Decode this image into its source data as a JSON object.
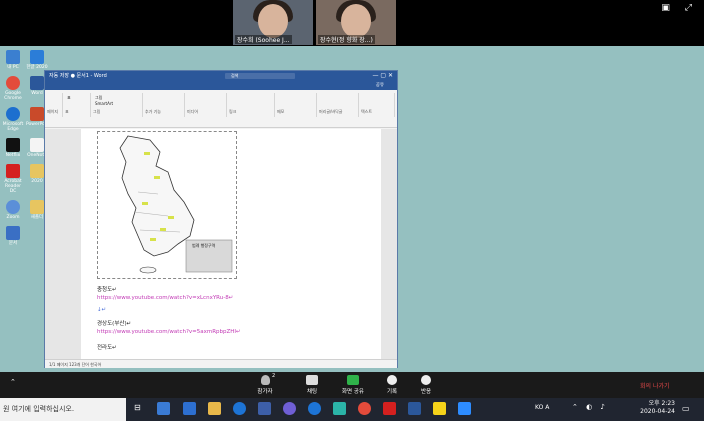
{
  "participants": [
    {
      "name": "장수희 (Soohee J..."
    },
    {
      "name": "장수현(정 향화 장...)"
    }
  ],
  "desktop_icons": [
    {
      "label": "내 PC"
    },
    {
      "label": "한글 2020"
    },
    {
      "label": "Google Chrome"
    },
    {
      "label": "Word"
    },
    {
      "label": "Microsoft Edge"
    },
    {
      "label": "PowerPoint"
    },
    {
      "label": "Netflix"
    },
    {
      "label": "OneNote"
    },
    {
      "label": "Acrobat Reader DC"
    },
    {
      "label": "2020"
    },
    {
      "label": "Zoom"
    },
    {
      "label": "새폴더"
    },
    {
      "label": "문서"
    }
  ],
  "word": {
    "title_bar": "자동 저장  ●  문서1 - Word",
    "search_placeholder": "검색",
    "tabs": [
      "파일",
      "홈",
      "삽입",
      "디자인",
      "레이아웃",
      "참조",
      "편지",
      "검토",
      "보기",
      "도움말",
      "그림 서식"
    ],
    "share": "공유",
    "ribbon_groups": [
      "표",
      "그림",
      "온라인 그림",
      "스크린샷",
      "SmartArt",
      "차트",
      "추가 기능",
      "온라인 비디오",
      "링크",
      "책갈피",
      "메모",
      "머리글",
      "바닥글",
      "페이지 번호",
      "텍스트 상자",
      "WordArt",
      "기호"
    ],
    "group_labels": [
      "페이지",
      "표",
      "그림",
      "추가 기능",
      "미디어",
      "링크",
      "메모",
      "머리글/바닥글",
      "텍스트",
      "기호"
    ],
    "doc": {
      "legend_title": "범례 행정구역",
      "line1": "충청도↵",
      "link1": "https://www.youtube.com/watch?v=xLcnxYRu-8↵",
      "line2": "↓↵",
      "line3": "경상도(부산)↵",
      "link2": "https://www.youtube.com/watch?v=5axmRpbpZHI↵",
      "line4": "전라도↵"
    },
    "status": "1/1 페이지   123개 단어   한국어"
  },
  "controls": [
    {
      "label": "참가자",
      "badge": "2"
    },
    {
      "label": "채팅"
    },
    {
      "label": "화면 공유"
    },
    {
      "label": "기록"
    },
    {
      "label": "반응"
    }
  ],
  "leave": "회의 나가기",
  "taskbar": {
    "search": "원 여기에 입력하십시오.",
    "time": "오후 2:23",
    "date": "2020-04-24",
    "lang": "A",
    "tray": "KO"
  },
  "colors": {
    "word_blue": "#2b579a",
    "desktop": "#95c0c0",
    "link": "#c23ab5",
    "leave": "#e24848"
  }
}
